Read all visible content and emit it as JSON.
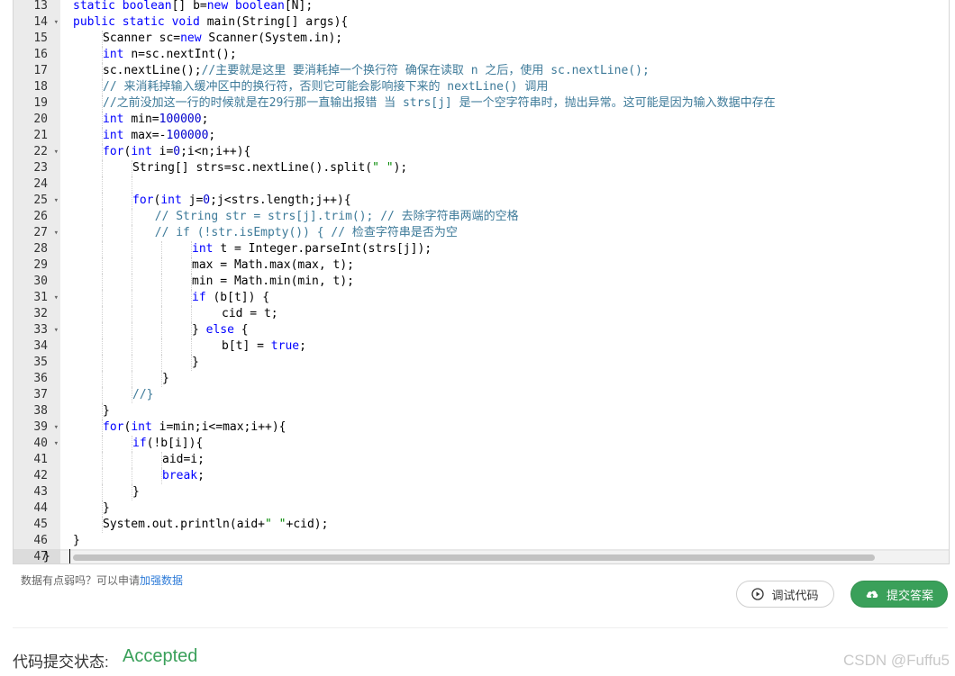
{
  "editor": {
    "lines": [
      {
        "n": "13",
        "fold": false,
        "indent": 1,
        "tokens": [
          [
            "kw",
            "static "
          ],
          [
            "kw",
            "boolean"
          ],
          [
            "",
            "[] b="
          ],
          [
            "kw",
            "new "
          ],
          [
            "kw",
            "boolean"
          ],
          [
            "",
            "[N];"
          ]
        ]
      },
      {
        "n": "14",
        "fold": true,
        "indent": 1,
        "tokens": [
          [
            "kw",
            "public static void "
          ],
          [
            "",
            "main(String[] args){"
          ]
        ]
      },
      {
        "n": "15",
        "fold": false,
        "indent": 2,
        "tokens": [
          [
            "",
            "Scanner sc="
          ],
          [
            "kw",
            "new "
          ],
          [
            "",
            "Scanner(System.in);"
          ]
        ]
      },
      {
        "n": "16",
        "fold": false,
        "indent": 2,
        "tokens": [
          [
            "kw",
            "int "
          ],
          [
            "",
            "n=sc.nextInt();"
          ]
        ]
      },
      {
        "n": "17",
        "fold": false,
        "indent": 2,
        "tokens": [
          [
            "",
            "sc.nextLine();"
          ],
          [
            "cm",
            "//主要就是这里 要消耗掉一个换行符 确保在读取 n 之后，使用 sc.nextLine();"
          ]
        ]
      },
      {
        "n": "18",
        "fold": false,
        "indent": 2,
        "tokens": [
          [
            "cm",
            "// 来消耗掉输入缓冲区中的换行符，否则它可能会影响接下来的 nextLine() 调用"
          ]
        ]
      },
      {
        "n": "19",
        "fold": false,
        "indent": 2,
        "tokens": [
          [
            "cm",
            "//之前没加这一行的时候就是在29行那一直输出报错 当 strs[j] 是一个空字符串时，抛出异常。这可能是因为输入数据中存在"
          ]
        ]
      },
      {
        "n": "20",
        "fold": false,
        "indent": 2,
        "tokens": [
          [
            "kw",
            "int "
          ],
          [
            "",
            "min="
          ],
          [
            "num",
            "100000"
          ],
          [
            "",
            ";"
          ]
        ]
      },
      {
        "n": "21",
        "fold": false,
        "indent": 2,
        "tokens": [
          [
            "kw",
            "int "
          ],
          [
            "",
            "max=-"
          ],
          [
            "num",
            "100000"
          ],
          [
            "",
            ";"
          ]
        ]
      },
      {
        "n": "22",
        "fold": true,
        "indent": 2,
        "tokens": [
          [
            "kw",
            "for"
          ],
          [
            "",
            "("
          ],
          [
            "kw",
            "int "
          ],
          [
            "",
            "i="
          ],
          [
            "num",
            "0"
          ],
          [
            "",
            ";i<n;i++){"
          ]
        ]
      },
      {
        "n": "23",
        "fold": false,
        "indent": 3,
        "tokens": [
          [
            "",
            "String[] strs=sc.nextLine().split("
          ],
          [
            "str",
            "\" \""
          ],
          [
            "",
            ");"
          ]
        ]
      },
      {
        "n": "24",
        "fold": false,
        "indent": 3,
        "tokens": []
      },
      {
        "n": "25",
        "fold": true,
        "indent": 3,
        "tokens": [
          [
            "kw",
            "for"
          ],
          [
            "",
            "("
          ],
          [
            "kw",
            "int "
          ],
          [
            "",
            "j="
          ],
          [
            "num",
            "0"
          ],
          [
            "",
            ";j<strs.length;j++){"
          ]
        ]
      },
      {
        "n": "26",
        "fold": false,
        "indent": 3.75,
        "tokens": [
          [
            "cm",
            "// String str = strs[j].trim(); // 去除字符串两端的空格"
          ]
        ]
      },
      {
        "n": "27",
        "fold": true,
        "indent": 3.75,
        "tokens": [
          [
            "cm",
            "// if (!str.isEmpty()) { // 检查字符串是否为空"
          ]
        ]
      },
      {
        "n": "28",
        "fold": false,
        "indent": 5,
        "tokens": [
          [
            "kw",
            "int "
          ],
          [
            "",
            "t = Integer.parseInt(strs[j]);"
          ]
        ]
      },
      {
        "n": "29",
        "fold": false,
        "indent": 5,
        "tokens": [
          [
            "",
            "max = Math.max(max, t);"
          ]
        ]
      },
      {
        "n": "30",
        "fold": false,
        "indent": 5,
        "tokens": [
          [
            "",
            "min = Math.min(min, t);"
          ]
        ]
      },
      {
        "n": "31",
        "fold": true,
        "indent": 5,
        "tokens": [
          [
            "kw",
            "if "
          ],
          [
            "",
            "(b[t]) {"
          ]
        ]
      },
      {
        "n": "32",
        "fold": false,
        "indent": 6,
        "tokens": [
          [
            "",
            "cid = t;"
          ]
        ]
      },
      {
        "n": "33",
        "fold": true,
        "indent": 5,
        "tokens": [
          [
            "",
            "} "
          ],
          [
            "kw",
            "else "
          ],
          [
            "",
            "{"
          ]
        ]
      },
      {
        "n": "34",
        "fold": false,
        "indent": 6,
        "tokens": [
          [
            "",
            "b[t] = "
          ],
          [
            "kw",
            "true"
          ],
          [
            "",
            ";"
          ]
        ]
      },
      {
        "n": "35",
        "fold": false,
        "indent": 5,
        "tokens": [
          [
            "",
            "}"
          ]
        ]
      },
      {
        "n": "36",
        "fold": false,
        "indent": 4,
        "tokens": [
          [
            "",
            "}"
          ]
        ]
      },
      {
        "n": "37",
        "fold": false,
        "indent": 3,
        "tokens": [
          [
            "cm",
            "//}"
          ]
        ]
      },
      {
        "n": "38",
        "fold": false,
        "indent": 2,
        "tokens": [
          [
            "",
            "}"
          ]
        ]
      },
      {
        "n": "39",
        "fold": true,
        "indent": 2,
        "tokens": [
          [
            "kw",
            "for"
          ],
          [
            "",
            "("
          ],
          [
            "kw",
            "int "
          ],
          [
            "",
            "i=min;i<=max;i++){"
          ]
        ]
      },
      {
        "n": "40",
        "fold": true,
        "indent": 3,
        "tokens": [
          [
            "kw",
            "if"
          ],
          [
            "",
            "(!b[i]){"
          ]
        ]
      },
      {
        "n": "41",
        "fold": false,
        "indent": 4,
        "tokens": [
          [
            "",
            "aid=i;"
          ]
        ]
      },
      {
        "n": "42",
        "fold": false,
        "indent": 4,
        "tokens": [
          [
            "kw",
            "break"
          ],
          [
            "",
            ";"
          ]
        ]
      },
      {
        "n": "43",
        "fold": false,
        "indent": 3,
        "tokens": [
          [
            "",
            "}"
          ]
        ]
      },
      {
        "n": "44",
        "fold": false,
        "indent": 2,
        "tokens": [
          [
            "",
            "}"
          ]
        ]
      },
      {
        "n": "45",
        "fold": false,
        "indent": 2,
        "tokens": [
          [
            "",
            "System.out.println(aid+"
          ],
          [
            "str",
            "\" \""
          ],
          [
            "",
            "+cid);"
          ]
        ]
      },
      {
        "n": "46",
        "fold": false,
        "indent": 1,
        "tokens": [
          [
            "",
            "}"
          ]
        ]
      },
      {
        "n": "47",
        "fold": false,
        "indent": 0,
        "tokens": [
          [
            "",
            "}"
          ]
        ]
      }
    ],
    "active_line": "47"
  },
  "hint": {
    "text": "数据有点弱吗？可以申请",
    "link": "加强数据"
  },
  "buttons": {
    "debug_label": "调试代码",
    "submit_label": "提交答案"
  },
  "status": {
    "label": "代码提交状态:",
    "value": "Accepted"
  },
  "watermark": "CSDN @Fuffu5",
  "colors": {
    "accent_green": "#3aa05a",
    "link_blue": "#2d7bd8",
    "keyword_blue": "#0000ff",
    "comment": "#3d7a99"
  }
}
